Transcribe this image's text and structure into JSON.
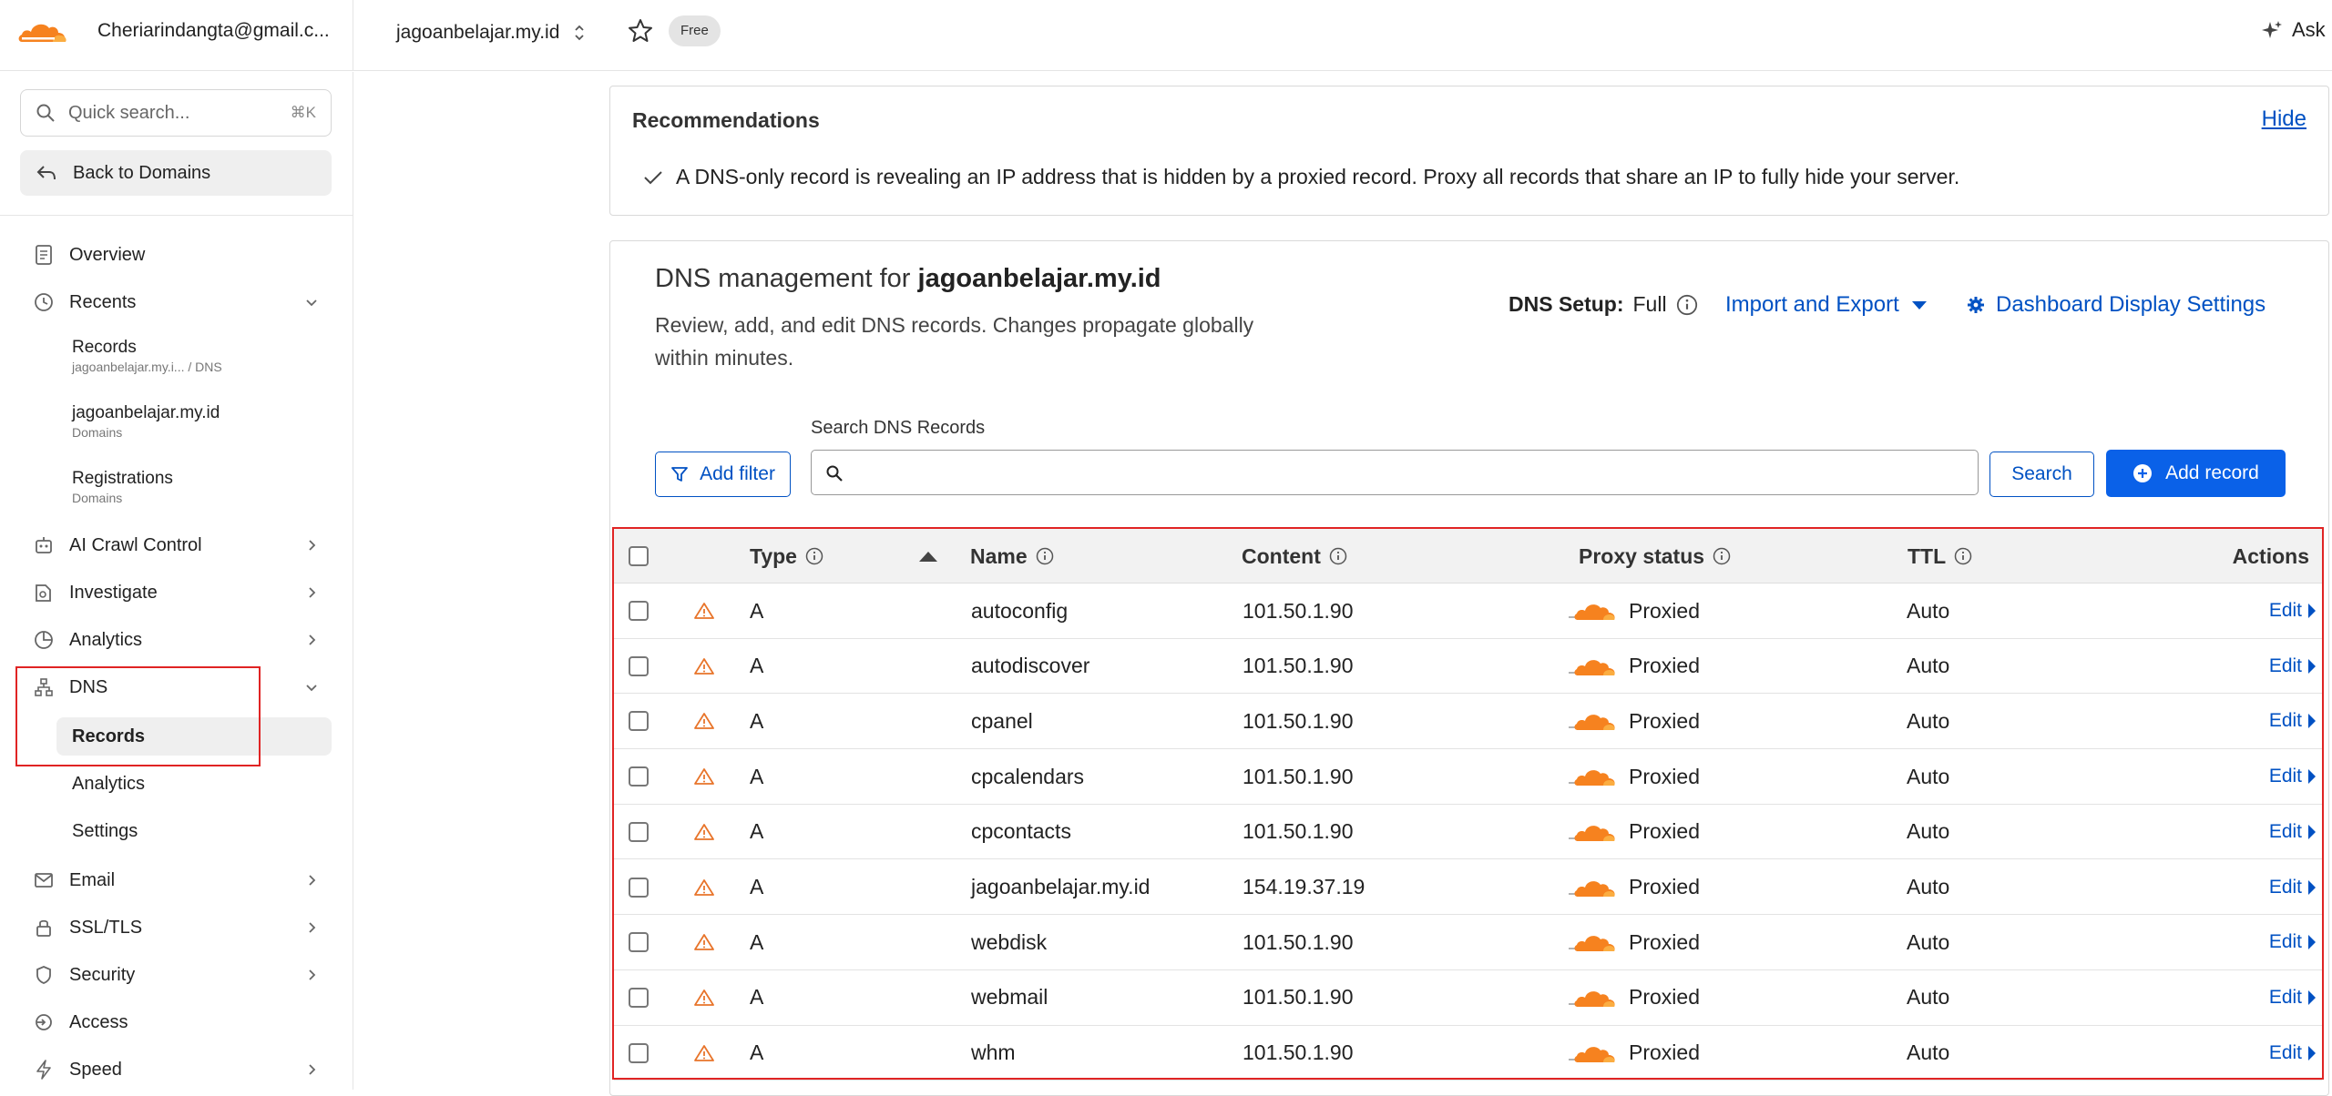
{
  "topbar": {
    "account": "Cheriarindangta@gmail.c...",
    "domain": "jagoanbelajar.my.id",
    "plan": "Free",
    "ask": "Ask"
  },
  "sidebar": {
    "search_placeholder": "Quick search...",
    "search_shortcut": "⌘K",
    "back_label": "Back to Domains",
    "overview": "Overview",
    "recents": {
      "label": "Recents",
      "items": [
        {
          "title": "Records",
          "sub": "jagoanbelajar.my.i...  /  DNS"
        },
        {
          "title": "jagoanbelajar.my.id",
          "sub": "Domains"
        },
        {
          "title": "Registrations",
          "sub": "Domains"
        }
      ]
    },
    "ai_crawl": "AI Crawl Control",
    "investigate": "Investigate",
    "analytics": "Analytics",
    "dns": {
      "label": "DNS",
      "items": [
        "Records",
        "Analytics",
        "Settings"
      ]
    },
    "email": "Email",
    "ssl": "SSL/TLS",
    "security": "Security",
    "access": "Access",
    "speed": "Speed"
  },
  "recommendations": {
    "title": "Recommendations",
    "hide": "Hide",
    "message": "A DNS-only record is revealing an IP address that is hidden by a proxied record. Proxy all records that share an IP to fully hide your server."
  },
  "dns": {
    "title_prefix": "DNS management for ",
    "title_domain": "jagoanbelajar.my.id",
    "description": "Review, add, and edit DNS records. Changes propagate globally within minutes.",
    "setup_label": "DNS Setup:",
    "setup_value": "Full",
    "import_export": "Import and Export",
    "display_settings": "Dashboard Display Settings",
    "add_filter": "Add filter",
    "search_label": "Search DNS Records",
    "search_value": "",
    "search_button": "Search",
    "add_record": "Add record"
  },
  "table": {
    "headers": {
      "type": "Type",
      "name": "Name",
      "content": "Content",
      "proxy": "Proxy status",
      "ttl": "TTL",
      "actions": "Actions"
    },
    "rows": [
      {
        "type": "A",
        "name": "autoconfig",
        "content": "101.50.1.90",
        "proxy": "Proxied",
        "ttl": "Auto",
        "action": "Edit"
      },
      {
        "type": "A",
        "name": "autodiscover",
        "content": "101.50.1.90",
        "proxy": "Proxied",
        "ttl": "Auto",
        "action": "Edit"
      },
      {
        "type": "A",
        "name": "cpanel",
        "content": "101.50.1.90",
        "proxy": "Proxied",
        "ttl": "Auto",
        "action": "Edit"
      },
      {
        "type": "A",
        "name": "cpcalendars",
        "content": "101.50.1.90",
        "proxy": "Proxied",
        "ttl": "Auto",
        "action": "Edit"
      },
      {
        "type": "A",
        "name": "cpcontacts",
        "content": "101.50.1.90",
        "proxy": "Proxied",
        "ttl": "Auto",
        "action": "Edit"
      },
      {
        "type": "A",
        "name": "jagoanbelajar.my.id",
        "content": "154.19.37.19",
        "proxy": "Proxied",
        "ttl": "Auto",
        "action": "Edit"
      },
      {
        "type": "A",
        "name": "webdisk",
        "content": "101.50.1.90",
        "proxy": "Proxied",
        "ttl": "Auto",
        "action": "Edit"
      },
      {
        "type": "A",
        "name": "webmail",
        "content": "101.50.1.90",
        "proxy": "Proxied",
        "ttl": "Auto",
        "action": "Edit"
      },
      {
        "type": "A",
        "name": "whm",
        "content": "101.50.1.90",
        "proxy": "Proxied",
        "ttl": "Auto",
        "action": "Edit"
      }
    ]
  },
  "colors": {
    "accent": "#0051c3",
    "brand": "#f6821f",
    "warning": "#e8742a",
    "highlight": "#e02424"
  },
  "icons": [
    "cloudflare-logo",
    "chevron-up-down-icon",
    "star-icon",
    "sparkle-icon",
    "search-icon",
    "back-arrow-icon",
    "document-icon",
    "clock-icon",
    "robot-icon",
    "investigate-icon",
    "pie-chart-icon",
    "network-icon",
    "mail-icon",
    "lock-icon",
    "shield-icon",
    "access-icon",
    "bolt-icon",
    "check-icon",
    "info-icon",
    "caret-down-icon",
    "gear-icon",
    "filter-icon",
    "plus-circle-icon",
    "warning-icon",
    "cloud-icon",
    "caret-right-icon",
    "sort-up-icon"
  ]
}
